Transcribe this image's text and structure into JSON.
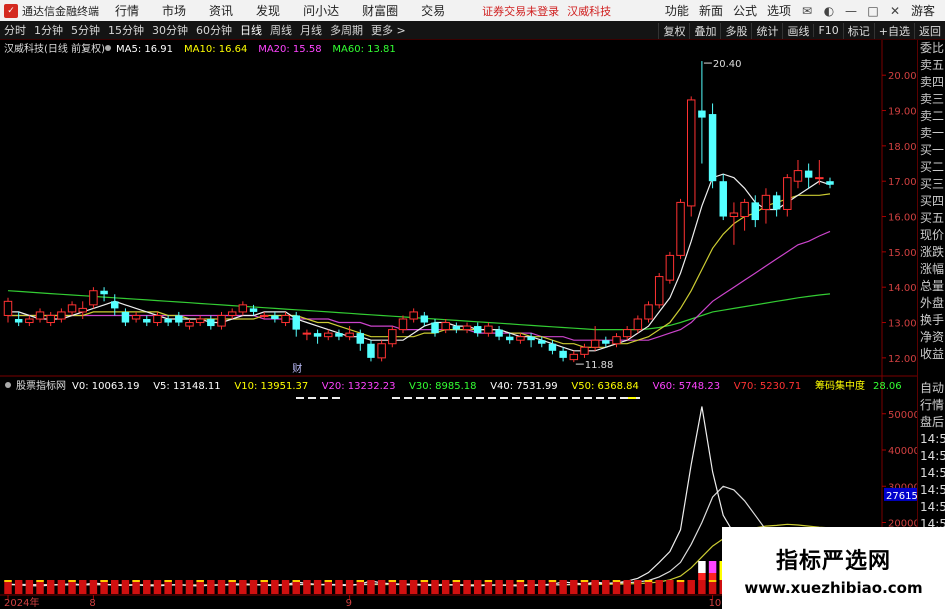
{
  "titlebar": {
    "app_name": "通达信金融终端",
    "menu": [
      "行情",
      "市场",
      "资讯",
      "发现",
      "问小达",
      "财富圈",
      "交易"
    ],
    "status": "证券交易未登录",
    "stock": "汉威科技",
    "right": [
      "功能",
      "新面",
      "公式",
      "选项"
    ],
    "login": "游客"
  },
  "periods": [
    "分时",
    "1分钟",
    "5分钟",
    "15分钟",
    "30分钟",
    "60分钟",
    "日线",
    "周线",
    "月线",
    "多周期",
    "更多 >"
  ],
  "active_period": "日线",
  "tools": [
    "复权",
    "叠加",
    "多股",
    "统计",
    "画线",
    "F10",
    "标记",
    "+自选",
    "返回"
  ],
  "sidepanel": [
    "委比",
    "卖五",
    "卖四",
    "卖三",
    "卖二",
    "卖一",
    "买一",
    "买二",
    "买三",
    "买四",
    "买五",
    "现价",
    "涨跌",
    "涨幅",
    "总量",
    "外盘",
    "换手",
    "净资",
    "收益",
    "",
    "自动",
    "行情",
    "盘后",
    "14:50",
    "14:50",
    "14:50",
    "14:50",
    "14:50",
    "14:50",
    "14:50"
  ],
  "watermark": {
    "cn": "指标严选网",
    "url": "www.xuezhibiao.com"
  },
  "chart_data": {
    "price_panel": {
      "title": "汉威科技(日线 前复权)",
      "ma_labels": [
        {
          "name": "MA5",
          "value": "16.91",
          "color": "#ffffff"
        },
        {
          "name": "MA10",
          "value": "16.64",
          "color": "#ffff00"
        },
        {
          "name": "MA20",
          "value": "15.58",
          "color": "#ff44ff"
        },
        {
          "name": "MA60",
          "value": "13.81",
          "color": "#33ff33"
        }
      ],
      "ylim": [
        11.6,
        20.6
      ],
      "y_ticks": [
        "20.00",
        "19.00",
        "18.00",
        "17.00",
        "16.00",
        "15.00",
        "14.00",
        "13.00",
        "12.00"
      ],
      "high_label": "20.40",
      "low_label": "11.88",
      "marker": "财",
      "candles": [
        [
          13.2,
          13.6,
          13.0,
          13.7
        ],
        [
          13.1,
          13.0,
          12.9,
          13.3
        ],
        [
          13.0,
          13.1,
          12.9,
          13.2
        ],
        [
          13.1,
          13.3,
          13.0,
          13.4
        ],
        [
          13.0,
          13.2,
          12.9,
          13.3
        ],
        [
          13.1,
          13.3,
          13.0,
          13.4
        ],
        [
          13.3,
          13.5,
          13.2,
          13.6
        ],
        [
          13.3,
          13.4,
          13.1,
          13.6
        ],
        [
          13.5,
          13.9,
          13.4,
          14.0
        ],
        [
          13.9,
          13.8,
          13.6,
          14.0
        ],
        [
          13.6,
          13.4,
          13.2,
          13.8
        ],
        [
          13.3,
          13.0,
          12.9,
          13.4
        ],
        [
          13.1,
          13.2,
          13.0,
          13.3
        ],
        [
          13.1,
          13.0,
          12.9,
          13.2
        ],
        [
          13.0,
          13.2,
          12.9,
          13.3
        ],
        [
          13.1,
          13.0,
          12.9,
          13.2
        ],
        [
          13.2,
          13.0,
          12.9,
          13.3
        ],
        [
          12.9,
          13.0,
          12.8,
          13.1
        ],
        [
          13.0,
          13.1,
          12.9,
          13.2
        ],
        [
          13.1,
          12.9,
          12.8,
          13.2
        ],
        [
          12.9,
          13.2,
          12.8,
          13.3
        ],
        [
          13.2,
          13.3,
          13.1,
          13.4
        ],
        [
          13.3,
          13.5,
          13.2,
          13.6
        ],
        [
          13.4,
          13.3,
          13.2,
          13.5
        ],
        [
          13.2,
          13.2,
          13.1,
          13.3
        ],
        [
          13.2,
          13.1,
          13.0,
          13.3
        ],
        [
          13.0,
          13.2,
          12.9,
          13.3
        ],
        [
          13.2,
          12.8,
          12.6,
          13.3
        ],
        [
          12.7,
          12.7,
          12.5,
          12.8
        ],
        [
          12.7,
          12.6,
          12.4,
          12.8
        ],
        [
          12.6,
          12.7,
          12.5,
          12.8
        ],
        [
          12.7,
          12.6,
          12.5,
          12.8
        ],
        [
          12.6,
          12.7,
          12.5,
          12.9
        ],
        [
          12.7,
          12.4,
          12.2,
          12.8
        ],
        [
          12.4,
          12.0,
          11.9,
          12.5
        ],
        [
          12.0,
          12.4,
          11.9,
          12.5
        ],
        [
          12.4,
          12.8,
          12.3,
          12.9
        ],
        [
          12.8,
          13.1,
          12.7,
          13.2
        ],
        [
          13.1,
          13.3,
          13.0,
          13.4
        ],
        [
          13.2,
          13.0,
          12.9,
          13.3
        ],
        [
          13.0,
          12.7,
          12.6,
          13.1
        ],
        [
          12.8,
          13.0,
          12.7,
          13.1
        ],
        [
          12.9,
          12.8,
          12.7,
          13.0
        ],
        [
          12.8,
          12.9,
          12.7,
          13.0
        ],
        [
          12.9,
          12.7,
          12.6,
          13.0
        ],
        [
          12.7,
          12.9,
          12.6,
          13.0
        ],
        [
          12.8,
          12.6,
          12.5,
          12.9
        ],
        [
          12.6,
          12.5,
          12.4,
          12.7
        ],
        [
          12.5,
          12.6,
          12.4,
          12.7
        ],
        [
          12.6,
          12.5,
          12.3,
          12.7
        ],
        [
          12.5,
          12.4,
          12.3,
          12.6
        ],
        [
          12.4,
          12.2,
          12.1,
          12.5
        ],
        [
          12.2,
          12.0,
          11.9,
          12.3
        ],
        [
          11.95,
          12.1,
          11.88,
          12.2
        ],
        [
          12.1,
          12.3,
          12.0,
          12.4
        ],
        [
          12.3,
          12.5,
          12.2,
          12.9
        ],
        [
          12.5,
          12.4,
          12.3,
          12.6
        ],
        [
          12.4,
          12.6,
          12.3,
          12.7
        ],
        [
          12.6,
          12.8,
          12.5,
          12.9
        ],
        [
          12.8,
          13.1,
          12.7,
          13.2
        ],
        [
          13.1,
          13.5,
          13.0,
          13.6
        ],
        [
          13.5,
          14.3,
          13.4,
          14.4
        ],
        [
          14.2,
          14.9,
          14.1,
          15.0
        ],
        [
          14.9,
          16.4,
          14.8,
          16.5
        ],
        [
          16.3,
          19.3,
          16.0,
          19.4
        ],
        [
          19.0,
          18.8,
          17.5,
          20.4
        ],
        [
          18.9,
          17.0,
          16.8,
          19.2
        ],
        [
          17.0,
          16.0,
          15.9,
          17.2
        ],
        [
          16.0,
          16.1,
          15.2,
          16.4
        ],
        [
          16.0,
          16.4,
          15.6,
          16.5
        ],
        [
          16.4,
          15.9,
          15.7,
          16.6
        ],
        [
          16.2,
          16.6,
          15.8,
          16.8
        ],
        [
          16.6,
          16.2,
          16.0,
          16.7
        ],
        [
          16.2,
          17.1,
          16.0,
          17.2
        ],
        [
          17.0,
          17.3,
          16.8,
          17.6
        ],
        [
          17.3,
          17.1,
          16.8,
          17.5
        ],
        [
          17.1,
          17.1,
          16.9,
          17.6
        ],
        [
          17.0,
          16.9,
          16.8,
          17.1
        ]
      ],
      "ma5": [
        13.3,
        13.3,
        13.2,
        13.1,
        13.1,
        13.1,
        13.2,
        13.3,
        13.4,
        13.5,
        13.6,
        13.5,
        13.4,
        13.3,
        13.2,
        13.1,
        13.1,
        13.1,
        13.1,
        13.0,
        13.0,
        13.1,
        13.2,
        13.2,
        13.3,
        13.3,
        13.3,
        13.1,
        13.0,
        12.9,
        12.8,
        12.7,
        12.6,
        12.6,
        12.5,
        12.5,
        12.5,
        12.5,
        12.7,
        12.9,
        13.0,
        13.0,
        12.9,
        12.9,
        12.8,
        12.8,
        12.8,
        12.7,
        12.6,
        12.6,
        12.5,
        12.4,
        12.3,
        12.2,
        12.2,
        12.2,
        12.3,
        12.4,
        12.5,
        12.7,
        12.9,
        13.3,
        13.7,
        14.4,
        15.3,
        16.3,
        17.1,
        17.2,
        17.1,
        16.8,
        16.4,
        16.2,
        16.2,
        16.4,
        16.6,
        16.8,
        17.0,
        16.9
      ],
      "ma10": [
        13.2,
        13.2,
        13.2,
        13.2,
        13.2,
        13.2,
        13.2,
        13.2,
        13.3,
        13.3,
        13.3,
        13.3,
        13.3,
        13.3,
        13.3,
        13.2,
        13.2,
        13.1,
        13.1,
        13.1,
        13.1,
        13.1,
        13.1,
        13.1,
        13.2,
        13.2,
        13.2,
        13.2,
        13.1,
        13.0,
        13.0,
        12.9,
        12.8,
        12.7,
        12.6,
        12.6,
        12.6,
        12.6,
        12.6,
        12.7,
        12.7,
        12.8,
        12.8,
        12.8,
        12.8,
        12.8,
        12.8,
        12.7,
        12.7,
        12.6,
        12.6,
        12.5,
        12.4,
        12.4,
        12.3,
        12.3,
        12.3,
        12.4,
        12.4,
        12.5,
        12.6,
        12.8,
        13.0,
        13.4,
        13.9,
        14.5,
        15.1,
        15.5,
        15.8,
        16.0,
        16.1,
        16.3,
        16.4,
        16.5,
        16.6,
        16.6,
        16.6,
        16.64
      ],
      "ma20": [
        13.2,
        13.2,
        13.2,
        13.2,
        13.2,
        13.2,
        13.2,
        13.2,
        13.2,
        13.2,
        13.2,
        13.2,
        13.2,
        13.2,
        13.2,
        13.2,
        13.2,
        13.2,
        13.2,
        13.2,
        13.2,
        13.2,
        13.2,
        13.2,
        13.1,
        13.1,
        13.1,
        13.1,
        13.1,
        13.1,
        13.1,
        13.0,
        13.0,
        13.0,
        12.9,
        12.9,
        12.9,
        12.8,
        12.8,
        12.8,
        12.8,
        12.8,
        12.8,
        12.8,
        12.7,
        12.7,
        12.7,
        12.7,
        12.7,
        12.7,
        12.6,
        12.6,
        12.6,
        12.5,
        12.5,
        12.5,
        12.5,
        12.5,
        12.5,
        12.5,
        12.5,
        12.6,
        12.7,
        12.8,
        13.0,
        13.3,
        13.6,
        13.8,
        14.0,
        14.2,
        14.4,
        14.6,
        14.8,
        15.0,
        15.2,
        15.3,
        15.45,
        15.58
      ],
      "ma60": [
        13.9,
        13.88,
        13.86,
        13.84,
        13.82,
        13.8,
        13.78,
        13.76,
        13.74,
        13.72,
        13.7,
        13.68,
        13.66,
        13.64,
        13.62,
        13.6,
        13.58,
        13.56,
        13.54,
        13.52,
        13.5,
        13.48,
        13.46,
        13.44,
        13.42,
        13.4,
        13.38,
        13.36,
        13.34,
        13.32,
        13.3,
        13.28,
        13.26,
        13.24,
        13.22,
        13.2,
        13.18,
        13.16,
        13.14,
        13.12,
        13.1,
        13.08,
        13.06,
        13.04,
        13.02,
        13.0,
        12.98,
        12.96,
        12.94,
        12.92,
        12.9,
        12.88,
        12.86,
        12.84,
        12.82,
        12.8,
        12.8,
        12.8,
        12.8,
        12.8,
        12.82,
        12.86,
        12.92,
        13.0,
        13.1,
        13.2,
        13.3,
        13.35,
        13.4,
        13.45,
        13.5,
        13.55,
        13.6,
        13.65,
        13.7,
        13.74,
        13.78,
        13.81
      ]
    },
    "volume_panel": {
      "title": "股票指标网",
      "labels": [
        {
          "text": "V0: 10063.19",
          "color": "#ffffff"
        },
        {
          "text": "V5: 13148.11",
          "color": "#ffffff"
        },
        {
          "text": "V10: 13951.37",
          "color": "#ffff00"
        },
        {
          "text": "V20: 13232.23",
          "color": "#ff44ff"
        },
        {
          "text": "V30: 8985.18",
          "color": "#33ff33"
        },
        {
          "text": "V40: 7531.99",
          "color": "#ffffff"
        },
        {
          "text": "V50: 6368.84",
          "color": "#ffff00"
        },
        {
          "text": "V60: 5748.23",
          "color": "#ff44ff"
        },
        {
          "text": "V70: 5230.71",
          "color": "#ff3333"
        },
        {
          "text": "筹码集中度",
          "color": "#ffff00"
        },
        {
          "text": "28.06",
          "color": "#33ff33"
        }
      ],
      "ylim": [
        0,
        56000
      ],
      "y_ticks": [
        "50000",
        "40000",
        "30000",
        "20000"
      ],
      "current_label": "27615.26",
      "volume_line": [
        3000,
        2800,
        2600,
        2500,
        2700,
        2900,
        3100,
        2800,
        3300,
        3000,
        2700,
        2600,
        2800,
        2600,
        2500,
        2700,
        2900,
        2600,
        2500,
        2700,
        2800,
        3000,
        3100,
        2900,
        2700,
        2600,
        2800,
        3600,
        3200,
        2900,
        2800,
        2700,
        2600,
        3000,
        3900,
        3300,
        3100,
        2900,
        2800,
        2700,
        2600,
        2700,
        2800,
        2600,
        2500,
        2700,
        2800,
        2600,
        2500,
        2700,
        2800,
        3000,
        3600,
        3300,
        3000,
        3600,
        3200,
        3400,
        3800,
        4600,
        6200,
        9000,
        12000,
        18000,
        36000,
        52000,
        34000,
        22000,
        17000,
        14000,
        12500,
        11000,
        10500,
        10800,
        11200,
        10600,
        10063,
        10063
      ],
      "ma_line_a": [
        2900,
        2900,
        2900,
        2850,
        2850,
        2800,
        2800,
        2800,
        2850,
        2850,
        2800,
        2800,
        2800,
        2750,
        2750,
        2750,
        2750,
        2700,
        2700,
        2700,
        2750,
        2800,
        2850,
        2850,
        2800,
        2800,
        2850,
        2900,
        2950,
        2950,
        2900,
        2900,
        2850,
        2900,
        3000,
        3050,
        3050,
        3000,
        2950,
        2900,
        2850,
        2800,
        2800,
        2750,
        2700,
        2700,
        2700,
        2700,
        2700,
        2700,
        2700,
        2750,
        2850,
        2950,
        3000,
        3100,
        3200,
        3300,
        3400,
        3600,
        4000,
        5000,
        6500,
        9000,
        14000,
        20000,
        27000,
        30000,
        29000,
        26000,
        22000,
        18000,
        15000,
        14000,
        13500,
        13300,
        13148,
        13148
      ],
      "ma_line_b": [
        2850,
        2850,
        2850,
        2850,
        2850,
        2850,
        2850,
        2850,
        2850,
        2850,
        2850,
        2850,
        2850,
        2850,
        2800,
        2800,
        2800,
        2800,
        2800,
        2800,
        2800,
        2800,
        2800,
        2800,
        2800,
        2800,
        2800,
        2850,
        2850,
        2850,
        2850,
        2850,
        2850,
        2850,
        2900,
        2900,
        2900,
        2900,
        2900,
        2900,
        2900,
        2900,
        2850,
        2850,
        2850,
        2800,
        2800,
        2800,
        2800,
        2800,
        2800,
        2800,
        2800,
        2850,
        2850,
        2900,
        2950,
        3000,
        3050,
        3150,
        3300,
        3600,
        4200,
        5200,
        7500,
        10500,
        13500,
        15500,
        17000,
        18000,
        18500,
        19000,
        19200,
        19500,
        19300,
        19000,
        18700,
        18500
      ]
    },
    "x_labels": [
      {
        "index": 0,
        "text": "2024年"
      },
      {
        "index": 8,
        "text": "8"
      },
      {
        "index": 32,
        "text": "9"
      },
      {
        "index": 66,
        "text": "10"
      }
    ]
  }
}
